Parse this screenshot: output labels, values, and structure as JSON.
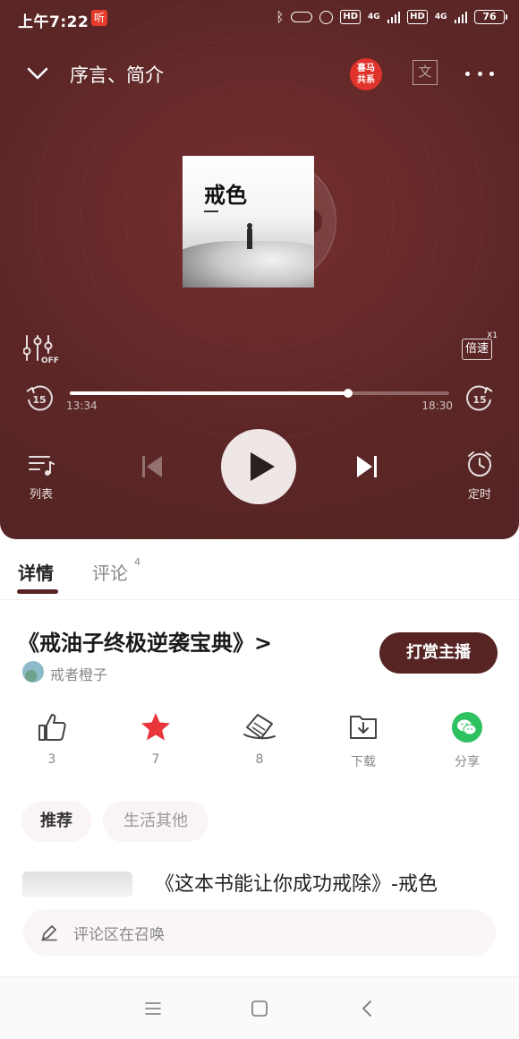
{
  "status_bar": {
    "time": "上午7:22",
    "app_badge": "听",
    "network_1": "4G",
    "network_2": "4G",
    "hd_1": "HD",
    "hd_2": "HD",
    "battery": "76"
  },
  "header": {
    "title": "序言、简介",
    "badge_text": "喜马\n共系",
    "translate_icon_text": "文"
  },
  "cover": {
    "title": "戒色"
  },
  "player": {
    "eq_label": "OFF",
    "speed_label": "倍速",
    "speed_multiplier": "X1",
    "skip_back_seconds": "15",
    "skip_forward_seconds": "15",
    "current_time": "13:34",
    "total_time": "18:30",
    "progress": 0.733,
    "list_label": "列表",
    "timer_label": "定时"
  },
  "tabs": {
    "detail": "详情",
    "comments": "评论",
    "comments_count": "4"
  },
  "album": {
    "title": "《戒油子终极逆袭宝典》>",
    "tip_button": "打赏主播",
    "author": "戒者橙子"
  },
  "actions": {
    "like_count": "3",
    "favorite_count": "7",
    "ticket_count": "8",
    "download_label": "下载",
    "share_label": "分享"
  },
  "chips": {
    "recommend": "推荐",
    "life": "生活其他"
  },
  "recommendation": {
    "title": "《这本书能让你成功戒除》-戒色"
  },
  "comment_bar": {
    "placeholder": "评论区在召唤"
  },
  "colors": {
    "player_bg": "#5c2626",
    "accent": "#572424",
    "favorite_red": "#e8353b",
    "wechat_green": "#2dc160"
  }
}
